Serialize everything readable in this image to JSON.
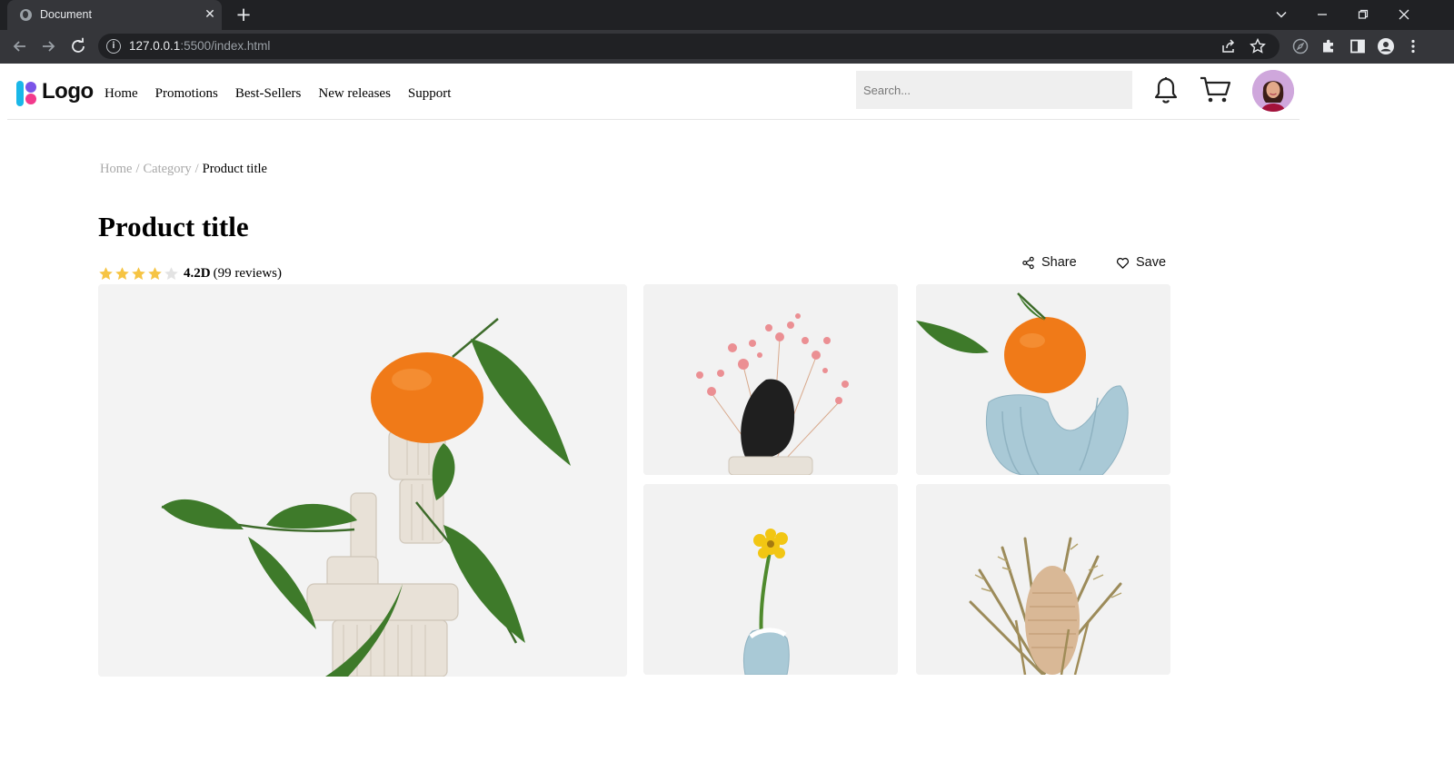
{
  "browser": {
    "tab_title": "Document",
    "url_host": "127.0.0.1",
    "url_rest": ":5500/index.html"
  },
  "site": {
    "logo_text": "Logo",
    "nav": [
      "Home",
      "Promotions",
      "Best-Sellers",
      "New releases",
      "Support"
    ],
    "search_placeholder": "Search..."
  },
  "breadcrumb": {
    "home": "Home",
    "category": "Category",
    "current": "Product title",
    "separator": "/"
  },
  "product": {
    "title": "Product title",
    "rating_value": "4.2D",
    "rating_stars": 4,
    "rating_max": 5,
    "reviews": "(99 reviews)",
    "share_label": "Share",
    "save_label": "Save"
  },
  "gallery": [
    {
      "subject": "orange on stacked clay tubes with leaves"
    },
    {
      "subject": "pink dried gypsophila with black stone"
    },
    {
      "subject": "orange on light blue clay sculpture"
    },
    {
      "subject": "yellow flower in light blue vase"
    },
    {
      "subject": "dried banksia bouquet"
    }
  ],
  "colors": {
    "star_filled": "#f6c443",
    "star_empty": "#e3e3e3",
    "chrome_dark": "#202124",
    "chrome_tab": "#35363a",
    "search_bg": "#efefef"
  }
}
